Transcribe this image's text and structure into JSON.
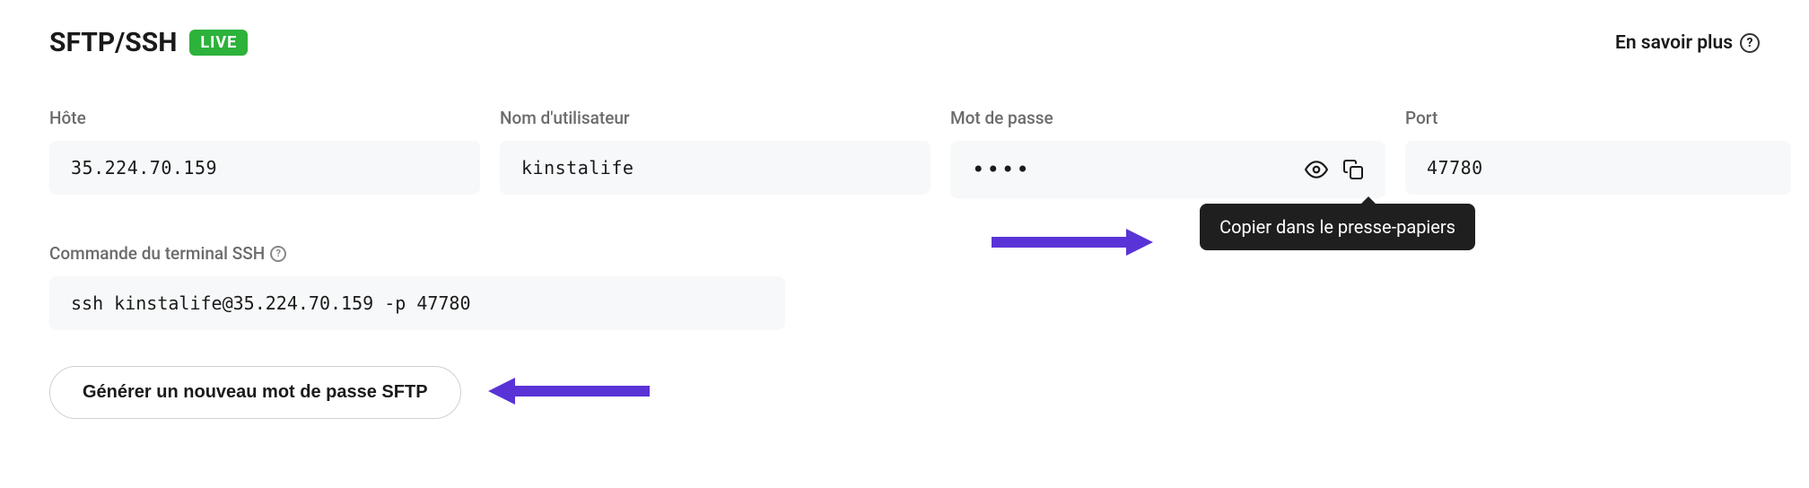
{
  "header": {
    "title": "SFTP/SSH",
    "badge": "LIVE",
    "learn_more": "En savoir plus"
  },
  "fields": {
    "host": {
      "label": "Hôte",
      "value": "35.224.70.159"
    },
    "username": {
      "label": "Nom d'utilisateur",
      "value": "kinstalife"
    },
    "password": {
      "label": "Mot de passe",
      "masked": "••••"
    },
    "port": {
      "label": "Port",
      "value": "47780"
    }
  },
  "ssh": {
    "label": "Commande du terminal SSH",
    "command": "ssh kinstalife@35.224.70.159 -p 47780"
  },
  "tooltip": "Copier dans le presse-papiers",
  "buttons": {
    "generate": "Générer un nouveau mot de passe SFTP"
  },
  "colors": {
    "badge_bg": "#2db23b",
    "arrow": "#5a33d6"
  }
}
